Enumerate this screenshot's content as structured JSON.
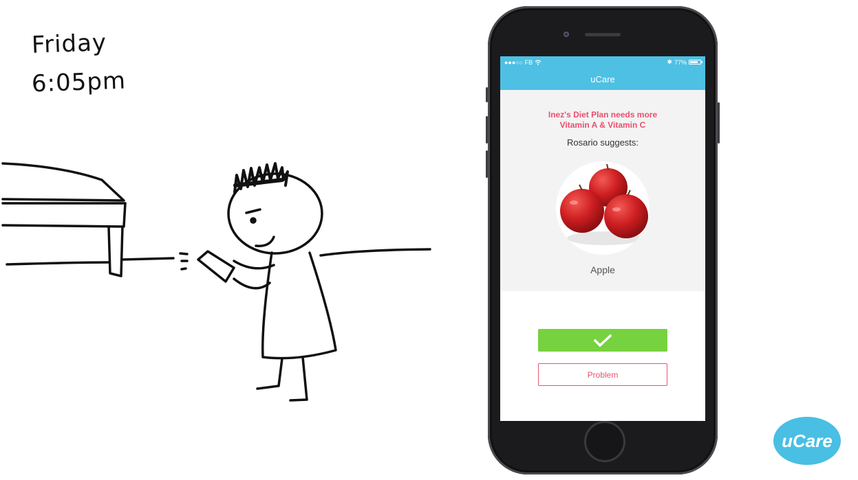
{
  "sketch": {
    "day": "Friday",
    "time": "6:05pm"
  },
  "phone": {
    "status_bar": {
      "carrier": "●●●○○ FB",
      "bluetooth": "✱",
      "battery": "77%"
    },
    "nav_title": "uCare",
    "alert_line1": "Inez's Diet Plan needs more",
    "alert_line2": "Vitamin A & Vitamin C",
    "suggest_text": "Rosario suggests:",
    "food_name": "Apple",
    "problem_label": "Problem"
  },
  "logo": {
    "text": "uCare"
  },
  "colors": {
    "accent": "#4ec0e3",
    "alert": "#ea4f6c",
    "confirm": "#77d23f"
  }
}
